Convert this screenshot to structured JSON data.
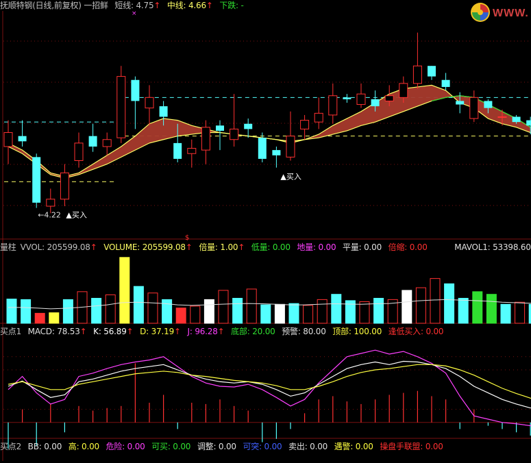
{
  "colors": {
    "up": "#ff3030",
    "down": "#54ffff",
    "ma_short": "#ffff66",
    "ma_mid": "#30d030",
    "ribbon": "#a83a2c",
    "white": "#ffffff",
    "magenta": "#ff40ff",
    "yellow": "#ffff40",
    "green": "#30e030",
    "blue": "#4060ff",
    "grid": "#7a1010"
  },
  "header": {
    "title": "抚顺特钢(日线,前复权) 一招鲜",
    "short_label": "短线:",
    "short_value": "4.75",
    "mid_label": "中线:",
    "mid_value": "4.66",
    "down_label": "下跌:",
    "down_value": "-",
    "arrow": "↑"
  },
  "logo": {
    "text": "WWW."
  },
  "panel1": {
    "low_marker": "←4.22",
    "buy_label_1": "▲买入",
    "buy_label_2": "▲买入",
    "mark_x": "×",
    "mark_s": "$"
  },
  "panel2_header": {
    "name": "量柱",
    "vvol_label": "VVOL:",
    "vvol_value": "205599.08",
    "volume_label": "VOLUME:",
    "volume_value": "205599.08",
    "beiliang_label": "倍量:",
    "beiliang_value": "1.00",
    "diliang_label": "低量:",
    "diliang_value": "0.00",
    "diliang2_label": "地量:",
    "diliang2_value": "0.00",
    "pingliang_label": "平量:",
    "pingliang_value": "0.00",
    "beisuo_label": "倍缩:",
    "beisuo_value": "0.00",
    "mavol_label": "MAVOL1:",
    "mavol_value": "53398.60"
  },
  "panel3_header": {
    "name": "买点1",
    "macd_label": "MACD:",
    "macd_value": "78.53",
    "k_label": "K:",
    "k_value": "56.89",
    "d_label": "D:",
    "d_value": "37.19",
    "j_label": "J:",
    "j_value": "96.28",
    "dibu_label": "底部:",
    "dibu_value": "20.00",
    "yujing_label": "预警:",
    "yujing_value": "80.00",
    "dingbu_label": "顶部:",
    "dingbu_value": "100.00",
    "fengdi_label": "逢低买入:",
    "fengdi_value": "0.00"
  },
  "footer": {
    "name": "买点2",
    "bb_label": "BB:",
    "bb_value": "0.00",
    "gao_label": "高:",
    "gao_value": "0.00",
    "weixian_label": "危险:",
    "weixian_value": "0.00",
    "kemai_label": "可买:",
    "kemai_value": "0.00",
    "tiaozheng_label": "调整:",
    "tiaozheng_value": "0.00",
    "ketu_label": "可突:",
    "ketu_value": "0.00",
    "maichu_label": "卖出:",
    "maichu_value": "0.00",
    "yujing_label": "遇警:",
    "yujing_value": "0.00",
    "caopan_label": "操盘手联盟:",
    "caopan_value": "0.00"
  },
  "chart_data": [
    {
      "type": "candlestick",
      "title": "抚顺特钢(日线,前复权)",
      "ylim": [
        4.1,
        5.35
      ],
      "series": [
        {
          "name": "短线",
          "values": [
            4.62,
            4.58,
            4.52,
            4.45,
            4.43,
            4.45,
            4.5,
            4.55,
            4.6,
            4.66,
            4.73,
            4.76,
            4.75,
            4.72,
            4.7,
            4.68,
            4.67,
            4.66,
            4.65,
            4.64,
            4.62,
            4.64,
            4.67,
            4.72,
            4.76,
            4.8,
            4.85,
            4.9,
            4.93,
            4.94,
            4.95,
            4.92,
            4.85,
            4.82,
            4.76,
            4.73,
            4.71,
            4.68,
            4.66
          ]
        },
        {
          "name": "中线",
          "values": [
            4.6,
            4.56,
            4.5,
            4.44,
            4.42,
            4.44,
            4.47,
            4.5,
            4.54,
            4.58,
            4.62,
            4.64,
            4.66,
            4.67,
            4.68,
            4.68,
            4.67,
            4.66,
            4.65,
            4.64,
            4.63,
            4.64,
            4.65,
            4.67,
            4.69,
            4.72,
            4.74,
            4.77,
            4.8,
            4.83,
            4.86,
            4.88,
            4.89,
            4.88,
            4.84,
            4.8,
            4.76,
            4.71,
            4.68
          ]
        }
      ],
      "candles": [
        {
          "o": 4.6,
          "c": 4.68,
          "h": 4.75,
          "l": 4.5
        },
        {
          "o": 4.66,
          "c": 4.63,
          "h": 4.75,
          "l": 4.6
        },
        {
          "o": 4.54,
          "c": 4.28,
          "h": 4.56,
          "l": 4.25
        },
        {
          "o": 4.26,
          "c": 4.3,
          "h": 4.36,
          "l": 4.22
        },
        {
          "o": 4.3,
          "c": 4.45,
          "h": 4.5,
          "l": 4.26
        },
        {
          "o": 4.52,
          "c": 4.62,
          "h": 4.68,
          "l": 4.48
        },
        {
          "o": 4.66,
          "c": 4.6,
          "h": 4.73,
          "l": 4.57
        },
        {
          "o": 4.6,
          "c": 4.64,
          "h": 4.68,
          "l": 4.55
        },
        {
          "o": 4.65,
          "c": 5.0,
          "h": 5.06,
          "l": 4.62
        },
        {
          "o": 4.98,
          "c": 4.86,
          "h": 5.0,
          "l": 4.7
        },
        {
          "o": 4.82,
          "c": 4.88,
          "h": 4.95,
          "l": 4.72
        },
        {
          "o": 4.83,
          "c": 4.77,
          "h": 4.86,
          "l": 4.72
        },
        {
          "o": 4.62,
          "c": 4.53,
          "h": 4.73,
          "l": 4.51
        },
        {
          "o": 4.56,
          "c": 4.59,
          "h": 4.64,
          "l": 4.48
        },
        {
          "o": 4.58,
          "c": 4.71,
          "h": 4.75,
          "l": 4.5
        },
        {
          "o": 4.72,
          "c": 4.69,
          "h": 4.75,
          "l": 4.58
        },
        {
          "o": 4.64,
          "c": 4.7,
          "h": 4.9,
          "l": 4.6
        },
        {
          "o": 4.73,
          "c": 4.7,
          "h": 4.76,
          "l": 4.65
        },
        {
          "o": 4.65,
          "c": 4.53,
          "h": 4.68,
          "l": 4.51
        },
        {
          "o": 4.58,
          "c": 4.55,
          "h": 4.6,
          "l": 4.48
        },
        {
          "o": 4.54,
          "c": 4.66,
          "h": 4.8,
          "l": 4.52
        },
        {
          "o": 4.7,
          "c": 4.75,
          "h": 4.78,
          "l": 4.64
        },
        {
          "o": 4.74,
          "c": 4.79,
          "h": 4.88,
          "l": 4.7
        },
        {
          "o": 4.78,
          "c": 4.89,
          "h": 4.96,
          "l": 4.73
        },
        {
          "o": 4.88,
          "c": 4.87,
          "h": 4.9,
          "l": 4.85
        },
        {
          "o": 4.84,
          "c": 4.9,
          "h": 4.96,
          "l": 4.82
        },
        {
          "o": 4.87,
          "c": 4.83,
          "h": 4.92,
          "l": 4.8
        },
        {
          "o": 4.86,
          "c": 4.89,
          "h": 4.95,
          "l": 4.83
        },
        {
          "o": 4.88,
          "c": 4.96,
          "h": 5.0,
          "l": 4.85
        },
        {
          "o": 4.96,
          "c": 5.06,
          "h": 5.25,
          "l": 4.93
        },
        {
          "o": 5.06,
          "c": 5.0,
          "h": 5.06,
          "l": 4.98
        },
        {
          "o": 4.98,
          "c": 4.94,
          "h": 5.02,
          "l": 4.92
        },
        {
          "o": 4.86,
          "c": 4.84,
          "h": 4.91,
          "l": 4.79
        },
        {
          "o": 4.76,
          "c": 4.88,
          "h": 4.92,
          "l": 4.74
        },
        {
          "o": 4.86,
          "c": 4.82,
          "h": 4.87,
          "l": 4.79
        },
        {
          "o": 4.77,
          "c": 4.77,
          "h": 4.81,
          "l": 4.72
        },
        {
          "o": 4.77,
          "c": 4.74,
          "h": 4.78,
          "l": 4.73
        },
        {
          "o": 4.75,
          "c": 4.72,
          "h": 4.77,
          "l": 4.67
        },
        {
          "o": 4.73,
          "c": 4.79,
          "h": 4.81,
          "l": 4.69
        }
      ],
      "levels": [
        {
          "value": 4.88,
          "color": "#54ffff",
          "from": 8
        },
        {
          "value": 4.74,
          "color": "#54ffff",
          "from": 0,
          "to": 8
        },
        {
          "value": 4.66,
          "color": "#ffff66",
          "from": 8
        },
        {
          "value": 4.4,
          "color": "#ffff66",
          "from": 0,
          "to": 8
        }
      ]
    },
    {
      "type": "bar",
      "title": "量柱",
      "ylim": [
        0,
        260000
      ],
      "values": [
        92000,
        90000,
        38000,
        40000,
        90000,
        120000,
        95000,
        108000,
        250000,
        140000,
        115000,
        90000,
        58000,
        65000,
        90000,
        125000,
        95000,
        130000,
        70000,
        72000,
        75000,
        68000,
        90000,
        110000,
        86000,
        82000,
        95000,
        90000,
        125000,
        135000,
        170000,
        150000,
        95000,
        120000,
        110000,
        72000,
        80000,
        72000,
        70000
      ],
      "kinds": [
        "down",
        "down",
        "upred",
        "yellow",
        "down",
        "up",
        "down",
        "up",
        "yellow",
        "down",
        "up",
        "down",
        "upred",
        "up",
        "white",
        "up",
        "down",
        "up",
        "down",
        "white",
        "down",
        "up",
        "up",
        "down",
        "down",
        "up",
        "down",
        "up",
        "white",
        "up",
        "up",
        "down",
        "down",
        "green",
        "green",
        "down",
        "up",
        "down",
        "down"
      ],
      "mavol": [
        60000,
        60000,
        58000,
        55000,
        57000,
        60000,
        65000,
        70000,
        78000,
        80000,
        78000,
        75000,
        70000,
        68000,
        70000,
        72000,
        74000,
        75000,
        74000,
        72000,
        70000,
        70000,
        72000,
        74000,
        73000,
        72000,
        74000,
        75000,
        80000,
        85000,
        88000,
        90000,
        88000,
        86000,
        84000,
        80000,
        78000,
        76000,
        74000
      ]
    },
    {
      "type": "line",
      "title": "买点1",
      "ylim": [
        -20,
        130
      ],
      "series": [
        {
          "name": "J",
          "values": [
            50,
            70,
            45,
            28,
            35,
            70,
            75,
            82,
            88,
            92,
            95,
            100,
            85,
            70,
            60,
            55,
            54,
            58,
            50,
            38,
            25,
            35,
            60,
            80,
            100,
            105,
            110,
            104,
            108,
            100,
            90,
            75,
            40,
            10,
            5,
            0,
            -2,
            -5,
            18
          ]
        },
        {
          "name": "K",
          "values": [
            55,
            63,
            50,
            38,
            42,
            62,
            66,
            72,
            78,
            82,
            85,
            88,
            80,
            72,
            66,
            62,
            60,
            62,
            58,
            50,
            40,
            45,
            58,
            70,
            82,
            88,
            92,
            88,
            93,
            92,
            88,
            82,
            70,
            55,
            45,
            35,
            28,
            22,
            25
          ]
        },
        {
          "name": "D",
          "values": [
            58,
            62,
            56,
            50,
            50,
            58,
            62,
            66,
            70,
            74,
            76,
            78,
            76,
            72,
            70,
            67,
            64,
            62,
            60,
            56,
            50,
            50,
            55,
            62,
            70,
            76,
            80,
            82,
            85,
            88,
            88,
            86,
            80,
            72,
            62,
            52,
            44,
            37,
            30
          ]
        }
      ],
      "macd": [
        -40,
        20,
        -35,
        28,
        -15,
        25,
        18,
        22,
        25,
        90,
        30,
        42,
        -10,
        30,
        28,
        35,
        25,
        18,
        -30,
        -25,
        -10,
        14,
        35,
        40,
        32,
        28,
        35,
        42,
        45,
        48,
        40,
        35,
        -10,
        20,
        -5,
        -10,
        -15,
        -20,
        -10
      ]
    }
  ]
}
